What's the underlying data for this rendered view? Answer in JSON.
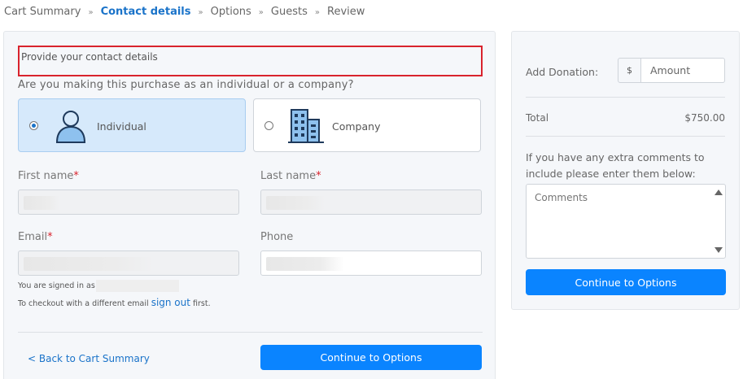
{
  "breadcrumb": {
    "items": [
      {
        "label": "Cart Summary",
        "active": false
      },
      {
        "label": "Contact details",
        "active": true
      },
      {
        "label": "Options",
        "active": false
      },
      {
        "label": "Guests",
        "active": false
      },
      {
        "label": "Review",
        "active": false
      }
    ],
    "separator": "»"
  },
  "form": {
    "section_title": "Provide your contact details",
    "question": "Are you making this purchase as an individual or a company?",
    "options": [
      {
        "label": "Individual",
        "selected": true,
        "icon": "person-icon"
      },
      {
        "label": "Company",
        "selected": false,
        "icon": "building-icon"
      }
    ],
    "first_name_label": "First name",
    "last_name_label": "Last name",
    "email_label": "Email",
    "phone_label": "Phone",
    "required_mark": "*",
    "signed_in_text": "You are signed in as",
    "checkout_text": "To checkout with a different email",
    "sign_out_label": "sign out",
    "first_text": "first.",
    "back_label": "< Back to Cart Summary",
    "continue_label": "Continue to Options"
  },
  "sidebar": {
    "donation_label": "Add Donation:",
    "currency_symbol": "$",
    "amount_placeholder": "Amount",
    "total_label": "Total",
    "total_value": "$750.00",
    "comments_prompt": "If you have any extra comments to include please enter them below:",
    "comments_placeholder": "Comments",
    "continue_label": "Continue to Options"
  },
  "colors": {
    "accent": "#0a84ff",
    "link": "#1a73c9",
    "required": "#d9232d",
    "selected_card": "#d6e9fb",
    "highlight_border": "#d9232d"
  }
}
